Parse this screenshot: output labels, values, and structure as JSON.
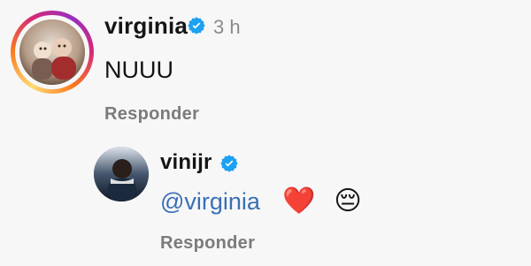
{
  "comments": [
    {
      "username": "virginia",
      "time": "3 h",
      "text": "NUUU",
      "reply_label": "Responder",
      "verified": true,
      "avatar_ring_colors": [
        "#feda75",
        "#fa7e1e",
        "#d62976",
        "#962fbf"
      ]
    },
    {
      "username": "vinijr",
      "mention": "@virginia",
      "reply_label": "Responder",
      "verified": true,
      "emoji": [
        "❤️",
        "😔"
      ]
    }
  ],
  "colors": {
    "background": "#f7f7f7",
    "verified_badge": "#1da1f2",
    "mention": "#3a6fb5",
    "reply": "#7b7b7b",
    "time": "#8a8a8a"
  },
  "icons": {
    "verified": "verified-badge-icon"
  }
}
